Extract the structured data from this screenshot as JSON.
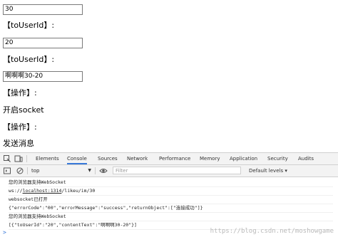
{
  "page": {
    "input1": "30",
    "label1": "【toUserId】:",
    "input2": "20",
    "label2": "【toUserId】:",
    "input3": "啊啊啊30-20",
    "label3": "【操作】:",
    "action1": "开启socket",
    "label4": "【操作】:",
    "action2": "发送消息"
  },
  "devtools": {
    "tabs": [
      "Elements",
      "Console",
      "Sources",
      "Network",
      "Performance",
      "Memory",
      "Application",
      "Security",
      "Audits"
    ],
    "active_tab": "Console",
    "context": "top",
    "filter_placeholder": "Filter",
    "levels": "Default levels ▾"
  },
  "console": {
    "lines": [
      "您的浏览器支持WebSocket",
      "ws://localhost:1314/likeu/im/30",
      "websocket已打开",
      "{\"errorCode\":\"00\",\"errorMessage\":\"success\",\"returnObject\":[\"连接成功\"]}",
      "您的浏览器支持WebSocket",
      "[{\"toUserId\":\"20\",\"contentText\":\"啊啊啊30-20\"}]"
    ],
    "url_prefix": "ws://",
    "url_link": "localhost:1314",
    "url_suffix": "/likeu/im/30",
    "prompt": ">"
  },
  "watermark": "https://blog.csdn.net/moshowgame",
  "colors": {
    "accent": "#3879d9",
    "border": "#7a7a7a"
  },
  "icons": [
    "inspect-icon",
    "device-toggle-icon",
    "console-drawer-icon",
    "clear-icon",
    "eye-icon",
    "more-icon",
    "close-icon"
  ]
}
